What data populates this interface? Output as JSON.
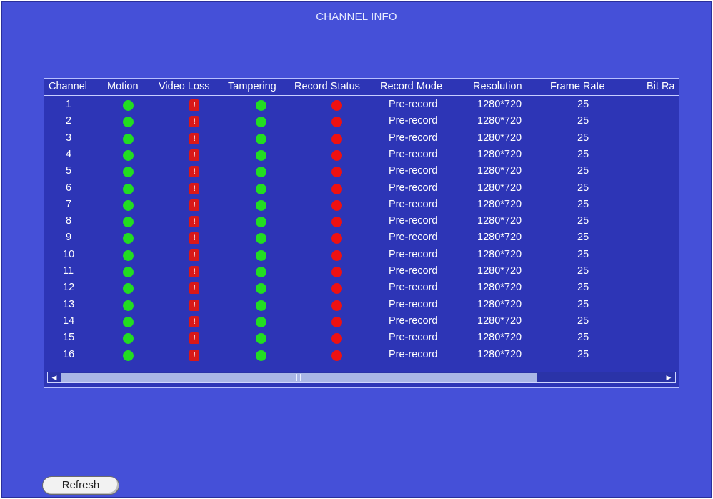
{
  "window": {
    "title": "CHANNEL INFO"
  },
  "table": {
    "columns": [
      "Channel",
      "Motion",
      "Video Loss",
      "Tampering",
      "Record Status",
      "Record Mode",
      "Resolution",
      "Frame Rate",
      "Bit Ra"
    ],
    "rows": [
      {
        "channel": "1",
        "motion": "ok",
        "video_loss": "alert",
        "tampering": "ok",
        "record_status": "stopped",
        "record_mode": "Pre-record",
        "resolution": "1280*720",
        "frame_rate": "25"
      },
      {
        "channel": "2",
        "motion": "ok",
        "video_loss": "alert",
        "tampering": "ok",
        "record_status": "stopped",
        "record_mode": "Pre-record",
        "resolution": "1280*720",
        "frame_rate": "25"
      },
      {
        "channel": "3",
        "motion": "ok",
        "video_loss": "alert",
        "tampering": "ok",
        "record_status": "stopped",
        "record_mode": "Pre-record",
        "resolution": "1280*720",
        "frame_rate": "25"
      },
      {
        "channel": "4",
        "motion": "ok",
        "video_loss": "alert",
        "tampering": "ok",
        "record_status": "stopped",
        "record_mode": "Pre-record",
        "resolution": "1280*720",
        "frame_rate": "25"
      },
      {
        "channel": "5",
        "motion": "ok",
        "video_loss": "alert",
        "tampering": "ok",
        "record_status": "stopped",
        "record_mode": "Pre-record",
        "resolution": "1280*720",
        "frame_rate": "25"
      },
      {
        "channel": "6",
        "motion": "ok",
        "video_loss": "alert",
        "tampering": "ok",
        "record_status": "stopped",
        "record_mode": "Pre-record",
        "resolution": "1280*720",
        "frame_rate": "25"
      },
      {
        "channel": "7",
        "motion": "ok",
        "video_loss": "alert",
        "tampering": "ok",
        "record_status": "stopped",
        "record_mode": "Pre-record",
        "resolution": "1280*720",
        "frame_rate": "25"
      },
      {
        "channel": "8",
        "motion": "ok",
        "video_loss": "alert",
        "tampering": "ok",
        "record_status": "stopped",
        "record_mode": "Pre-record",
        "resolution": "1280*720",
        "frame_rate": "25"
      },
      {
        "channel": "9",
        "motion": "ok",
        "video_loss": "alert",
        "tampering": "ok",
        "record_status": "stopped",
        "record_mode": "Pre-record",
        "resolution": "1280*720",
        "frame_rate": "25"
      },
      {
        "channel": "10",
        "motion": "ok",
        "video_loss": "alert",
        "tampering": "ok",
        "record_status": "stopped",
        "record_mode": "Pre-record",
        "resolution": "1280*720",
        "frame_rate": "25"
      },
      {
        "channel": "11",
        "motion": "ok",
        "video_loss": "alert",
        "tampering": "ok",
        "record_status": "stopped",
        "record_mode": "Pre-record",
        "resolution": "1280*720",
        "frame_rate": "25"
      },
      {
        "channel": "12",
        "motion": "ok",
        "video_loss": "alert",
        "tampering": "ok",
        "record_status": "stopped",
        "record_mode": "Pre-record",
        "resolution": "1280*720",
        "frame_rate": "25"
      },
      {
        "channel": "13",
        "motion": "ok",
        "video_loss": "alert",
        "tampering": "ok",
        "record_status": "stopped",
        "record_mode": "Pre-record",
        "resolution": "1280*720",
        "frame_rate": "25"
      },
      {
        "channel": "14",
        "motion": "ok",
        "video_loss": "alert",
        "tampering": "ok",
        "record_status": "stopped",
        "record_mode": "Pre-record",
        "resolution": "1280*720",
        "frame_rate": "25"
      },
      {
        "channel": "15",
        "motion": "ok",
        "video_loss": "alert",
        "tampering": "ok",
        "record_status": "stopped",
        "record_mode": "Pre-record",
        "resolution": "1280*720",
        "frame_rate": "25"
      },
      {
        "channel": "16",
        "motion": "ok",
        "video_loss": "alert",
        "tampering": "ok",
        "record_status": "stopped",
        "record_mode": "Pre-record",
        "resolution": "1280*720",
        "frame_rate": "25"
      }
    ],
    "alert_glyph": "!"
  },
  "status_icons": {
    "ok": "green-dot-icon",
    "alert": "video-loss-warning-icon",
    "stopped": "red-dot-icon"
  },
  "colors": {
    "background": "#4550d8",
    "panel": "#2d35b6",
    "ok": "#22dd22",
    "alert": "#ee1111"
  },
  "buttons": {
    "refresh_label": "Refresh"
  }
}
